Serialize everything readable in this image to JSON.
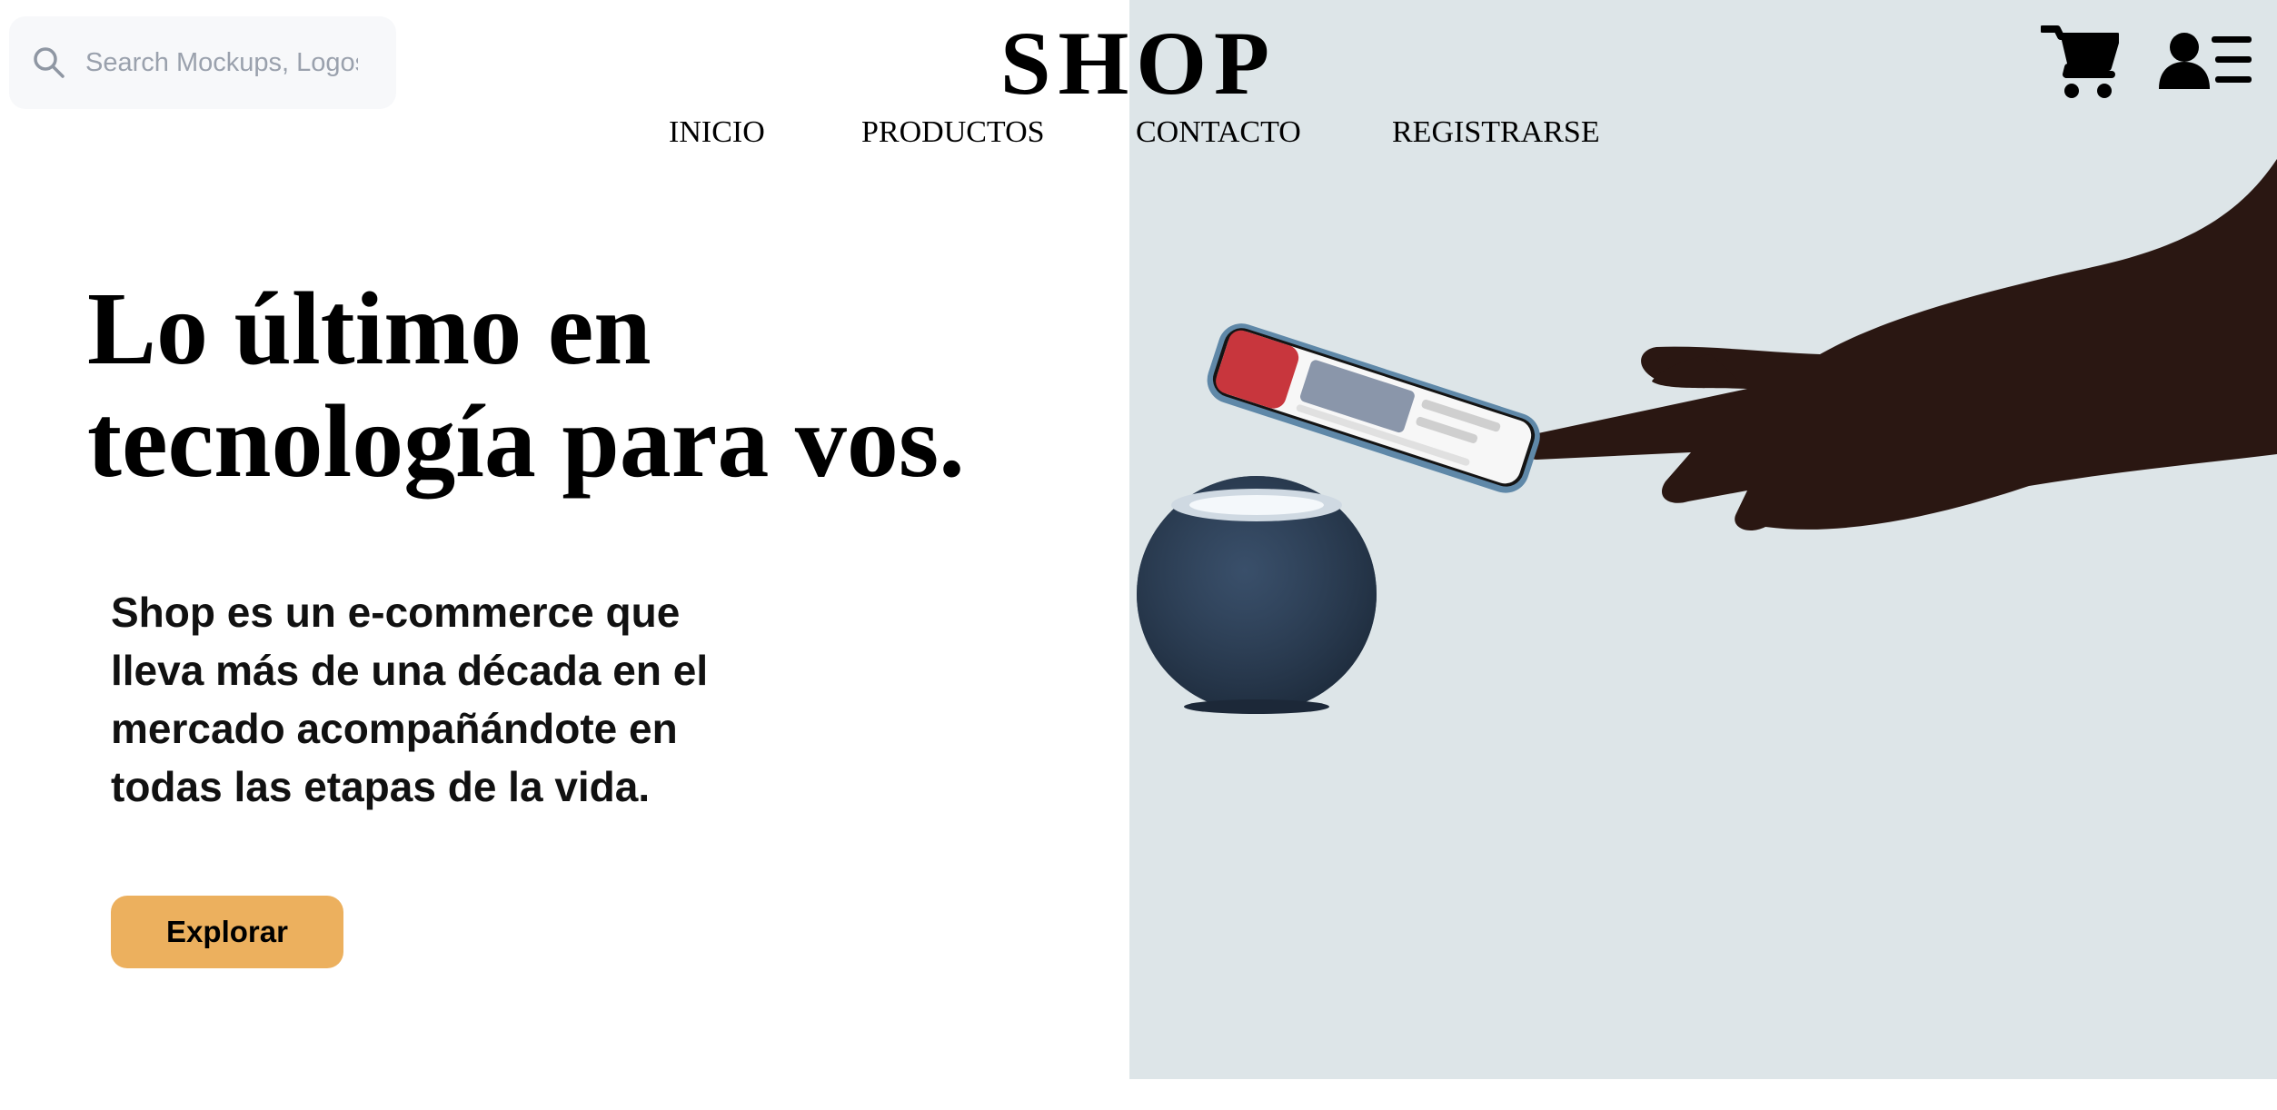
{
  "header": {
    "search": {
      "placeholder": "Search Mockups, Logos..."
    },
    "logo": "SHOP",
    "nav": [
      {
        "label": "INICIO"
      },
      {
        "label": "PRODUCTOS"
      },
      {
        "label": "CONTACTO"
      },
      {
        "label": "REGISTRARSE"
      }
    ],
    "icons": [
      "cart-icon",
      "user-menu-icon",
      "search-icon"
    ]
  },
  "hero": {
    "title_line1": "Lo último en",
    "title_line2": "tecnología para vos.",
    "description": "Shop es un e-commerce que lleva más de una década en el mercado acompañándote en todas las etapas de la vida.",
    "cta_label": "Explorar"
  },
  "colors": {
    "hero_panel": "#dde5e8",
    "cta_background": "#ecb05e",
    "search_background": "#f7f8fa",
    "text": "#000000"
  }
}
